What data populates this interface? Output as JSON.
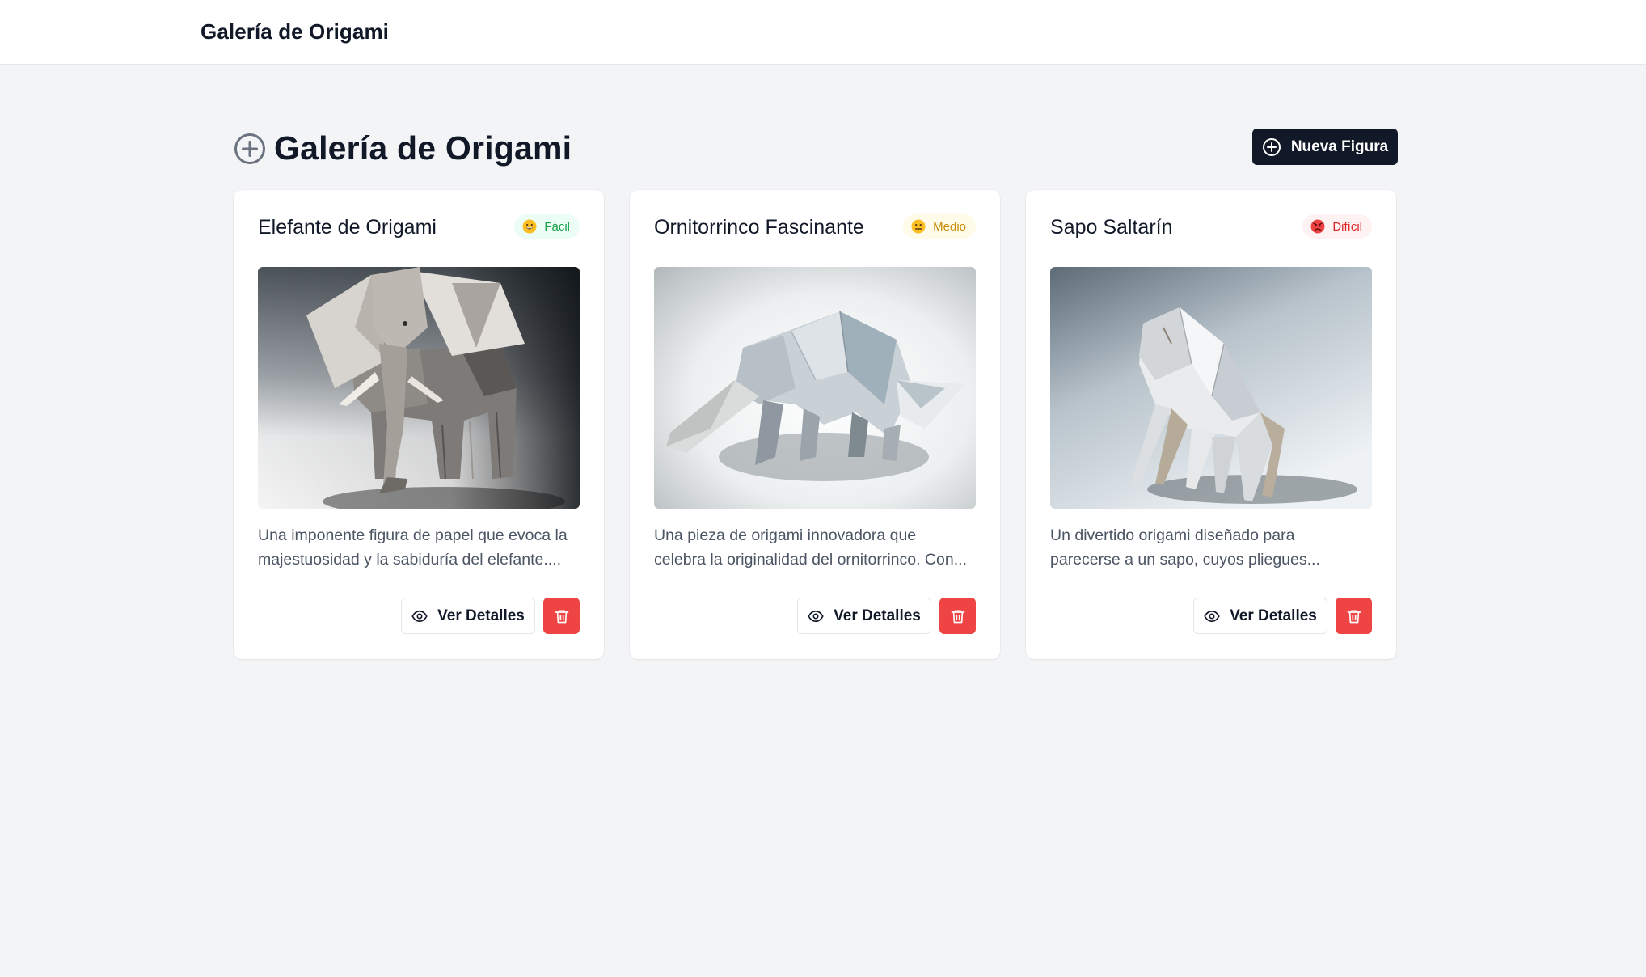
{
  "navbar": {
    "title": "Galería de Origami"
  },
  "header": {
    "title": "Galería de Origami",
    "new_button_label": "Nueva Figura"
  },
  "colors": {
    "primary": "#111827",
    "background": "#f3f4f6",
    "danger": "#ef4444",
    "easy": "#16a34a",
    "medium": "#ca8a04",
    "hard": "#dc2626"
  },
  "cards": [
    {
      "title": "Elefante de Origami",
      "difficulty": "Fácil",
      "difficulty_icon": "grinning-face-icon",
      "image": "origami-elephant-image",
      "description_lines": [
        "Una imponente figura de papel que evoca la",
        "majestuosidad y la sabiduría del elefante...."
      ],
      "details_label": "Ver Detalles"
    },
    {
      "title": "Ornitorrinco Fascinante",
      "difficulty": "Medio",
      "difficulty_icon": "neutral-face-icon",
      "image": "origami-platypus-image",
      "description_lines": [
        "Una pieza de origami innovadora que",
        "celebra la originalidad del ornitorrinco. Con..."
      ],
      "details_label": "Ver Detalles"
    },
    {
      "title": "Sapo Saltarín",
      "difficulty": "Difícil",
      "difficulty_icon": "angry-face-icon",
      "image": "origami-frog-image",
      "description_lines": [
        "Un divertido origami diseñado para",
        "parecerse a un sapo, cuyos pliegues..."
      ],
      "details_label": "Ver Detalles"
    }
  ]
}
